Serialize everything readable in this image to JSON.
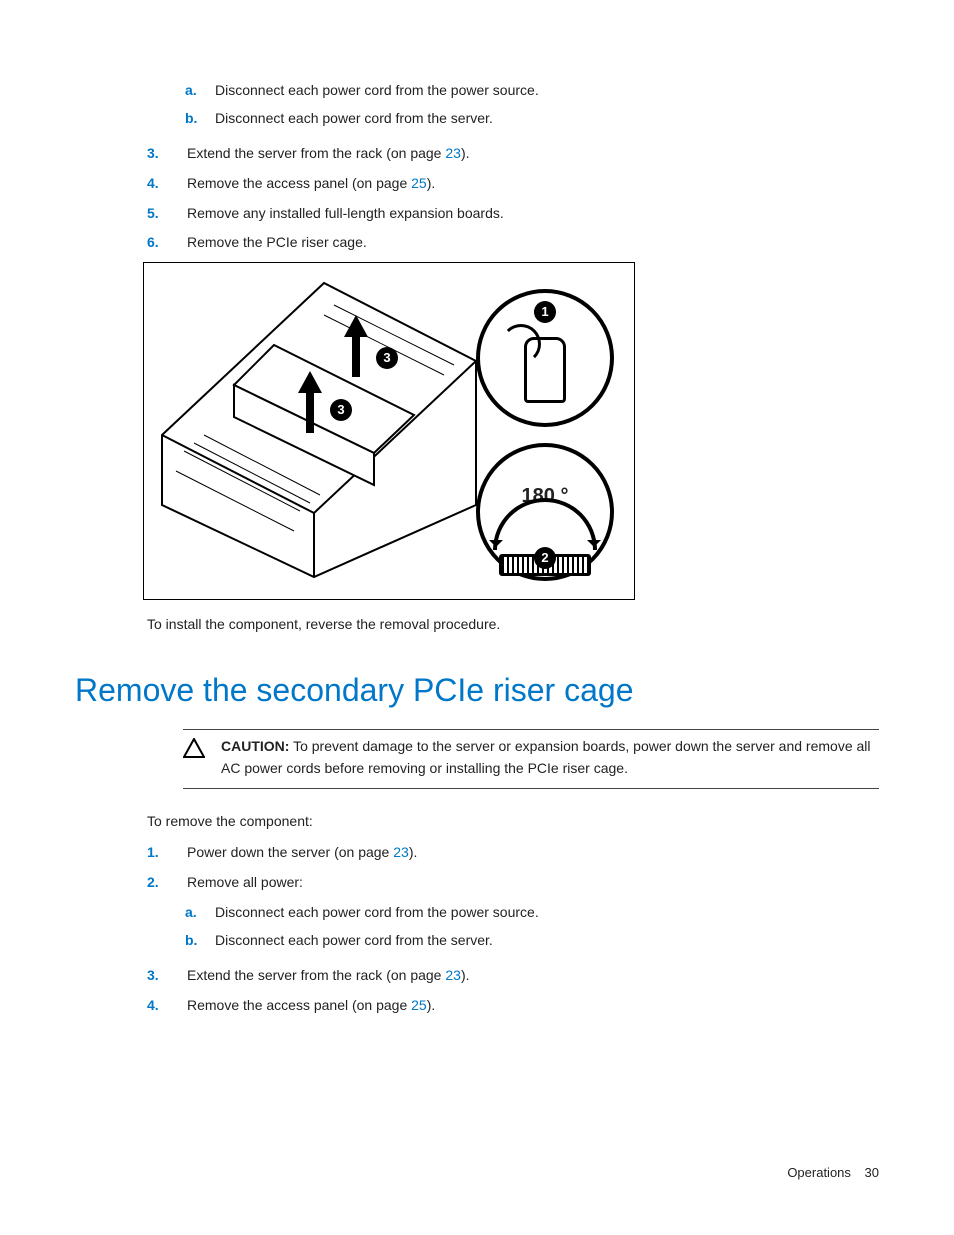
{
  "sublist_top": [
    {
      "marker": "a.",
      "text": "Disconnect each power cord from the power source."
    },
    {
      "marker": "b.",
      "text": "Disconnect each power cord from the server."
    }
  ],
  "numlist_top": [
    {
      "marker": "3.",
      "pre": "Extend the server from the rack (on page ",
      "ref": "23",
      "post": ")."
    },
    {
      "marker": "4.",
      "pre": "Remove the access panel (on page ",
      "ref": "25",
      "post": ")."
    },
    {
      "marker": "5.",
      "pre": "Remove any installed full-length expansion boards.",
      "ref": "",
      "post": ""
    },
    {
      "marker": "6.",
      "pre": "Remove the PCIe riser cage.",
      "ref": "",
      "post": ""
    }
  ],
  "diagram": {
    "callout1": "1",
    "callout2": "2",
    "callout3a": "3",
    "callout3b": "3",
    "angle": "180 °"
  },
  "install_note": "To install the component, reverse the removal procedure.",
  "heading": "Remove the secondary PCIe riser cage",
  "caution": {
    "label": "CAUTION:",
    "text": " To prevent damage to the server or expansion boards, power down the server and remove all AC power cords before removing or installing the PCIe riser cage."
  },
  "intro": "To remove the component:",
  "numlist_bot": [
    {
      "marker": "1.",
      "pre": "Power down the server (on page ",
      "ref": "23",
      "post": ")."
    },
    {
      "marker": "2.",
      "pre": "Remove all power:",
      "ref": "",
      "post": ""
    }
  ],
  "sublist_bot": [
    {
      "marker": "a.",
      "text": "Disconnect each power cord from the power source."
    },
    {
      "marker": "b.",
      "text": "Disconnect each power cord from the server."
    }
  ],
  "numlist_bot2": [
    {
      "marker": "3.",
      "pre": "Extend the server from the rack (on page ",
      "ref": "23",
      "post": ")."
    },
    {
      "marker": "4.",
      "pre": "Remove the access panel (on page ",
      "ref": "25",
      "post": ")."
    }
  ],
  "footer": {
    "section": "Operations",
    "page": "30"
  }
}
